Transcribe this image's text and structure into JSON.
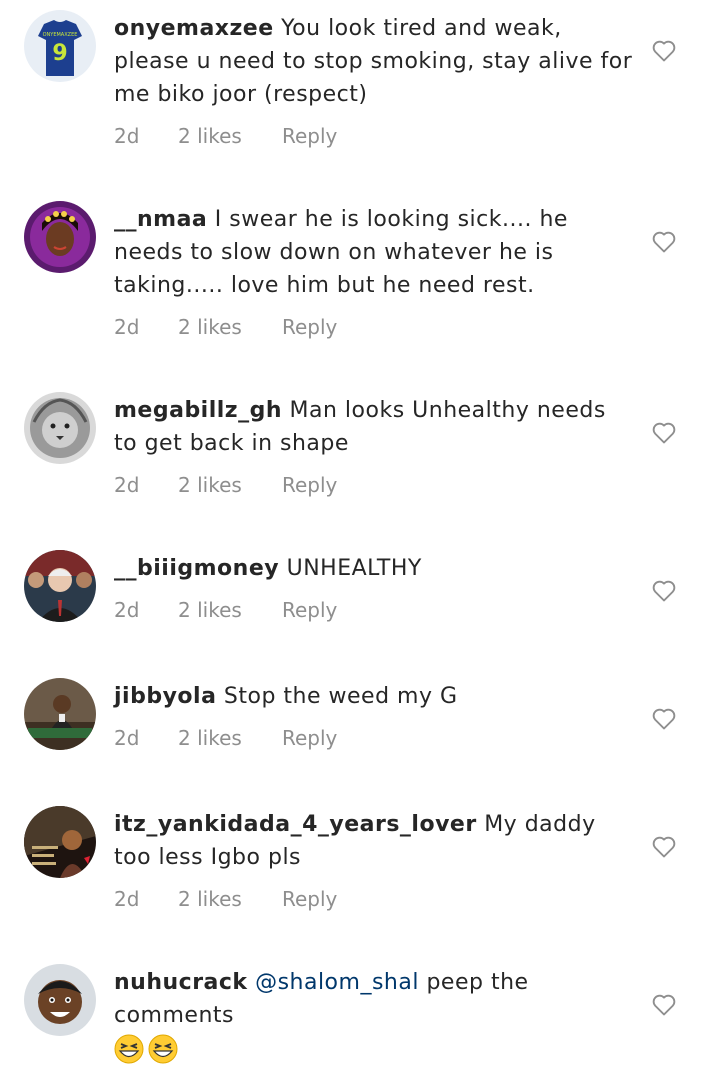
{
  "comments": [
    {
      "username": "onyemaxzee",
      "text": "You look tired and weak, please u need to stop smoking, stay alive for me biko joor (respect)",
      "time": "2d",
      "likes": "2 likes",
      "reply": "Reply",
      "avatar_icon": "jersey-9-avatar"
    },
    {
      "username": "__nmaa",
      "text": "I swear he is looking sick.... he needs to slow down on whatever he is taking..... love him but he need rest.",
      "time": "2d",
      "likes": "2 likes",
      "reply": "Reply",
      "avatar_icon": "woman-portrait-avatar"
    },
    {
      "username": "megabillz_gh",
      "text": "Man looks Unhealthy needs to get back in shape",
      "time": "2d",
      "likes": "2 likes",
      "reply": "Reply",
      "avatar_icon": "lion-avatar"
    },
    {
      "username": "__biiigmoney",
      "text": "UNHEALTHY",
      "time": "2d",
      "likes": "2 likes",
      "reply": "Reply",
      "avatar_icon": "man-in-crowd-avatar"
    },
    {
      "username": "jibbyola",
      "text": "Stop the weed my G",
      "time": "2d",
      "likes": "2 likes",
      "reply": "Reply",
      "avatar_icon": "child-at-desk-avatar"
    },
    {
      "username": "itz_yankidada_4_years_lover",
      "text": "My daddy too less Igbo pls",
      "time": "2d",
      "likes": "2 likes",
      "reply": "Reply",
      "avatar_icon": "poster-avatar"
    },
    {
      "username": "nuhucrack",
      "mention": "@shalom_shal",
      "text": "peep the comments",
      "emoji": [
        "grinning-squint-face-emoji",
        "grinning-squint-face-emoji"
      ],
      "avatar_icon": "smiling-boy-avatar"
    }
  ],
  "colors": {
    "text": "#262626",
    "meta": "#8e8e8e",
    "mention": "#00376b",
    "heart_outline": "#8e8e8e"
  },
  "icons": {
    "like": "heart-outline-icon"
  }
}
